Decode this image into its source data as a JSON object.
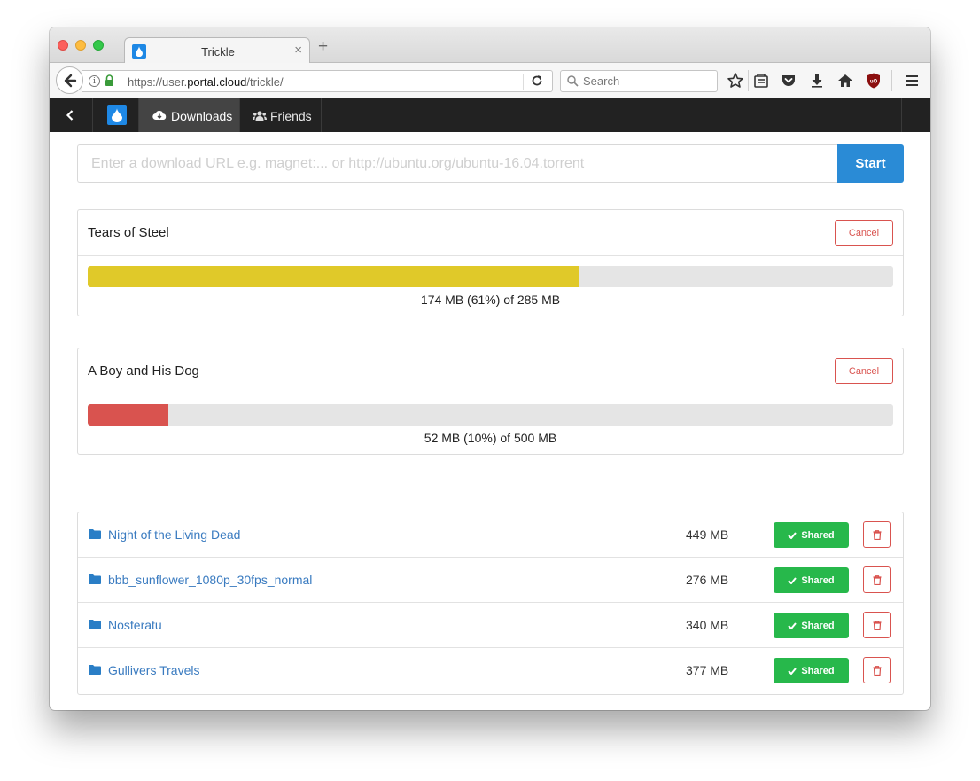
{
  "browser": {
    "tab_title": "Trickle",
    "tab_close_glyph": "×",
    "new_tab_glyph": "+",
    "url_prefix": "https://user.",
    "url_domain": "portal.cloud",
    "url_path": "/trickle/",
    "search_placeholder": "Search",
    "info_glyph": "i"
  },
  "app_nav": {
    "tabs": [
      {
        "label": "Downloads",
        "icon": "cloud-download-icon",
        "active": true
      },
      {
        "label": "Friends",
        "icon": "users-icon",
        "active": false
      }
    ]
  },
  "download_form": {
    "placeholder": "Enter a download URL e.g. magnet:... or http://ubuntu.org/ubuntu-16.04.torrent",
    "start_label": "Start"
  },
  "active_downloads": [
    {
      "title": "Tears of Steel",
      "cancel_label": "Cancel",
      "progress": 0.61,
      "progress_text": "174 MB (61%) of 285 MB",
      "bar_color": "#e0c929"
    },
    {
      "title": "A Boy and His Dog",
      "cancel_label": "Cancel",
      "progress": 0.1,
      "progress_text": "52 MB (10%) of 500 MB",
      "bar_color": "#d9534f"
    }
  ],
  "files": [
    {
      "name": "Night of the Living Dead",
      "size": "449 MB",
      "shared_label": "Shared"
    },
    {
      "name": "bbb_sunflower_1080p_30fps_normal",
      "size": "276 MB",
      "shared_label": "Shared"
    },
    {
      "name": "Nosferatu",
      "size": "340 MB",
      "shared_label": "Shared"
    },
    {
      "name": "Gullivers Travels",
      "size": "377 MB",
      "shared_label": "Shared"
    }
  ],
  "colors": {
    "accent": "#2a8bd6",
    "success": "#27b84b",
    "danger": "#d9534f",
    "nav_bg": "#222222"
  }
}
